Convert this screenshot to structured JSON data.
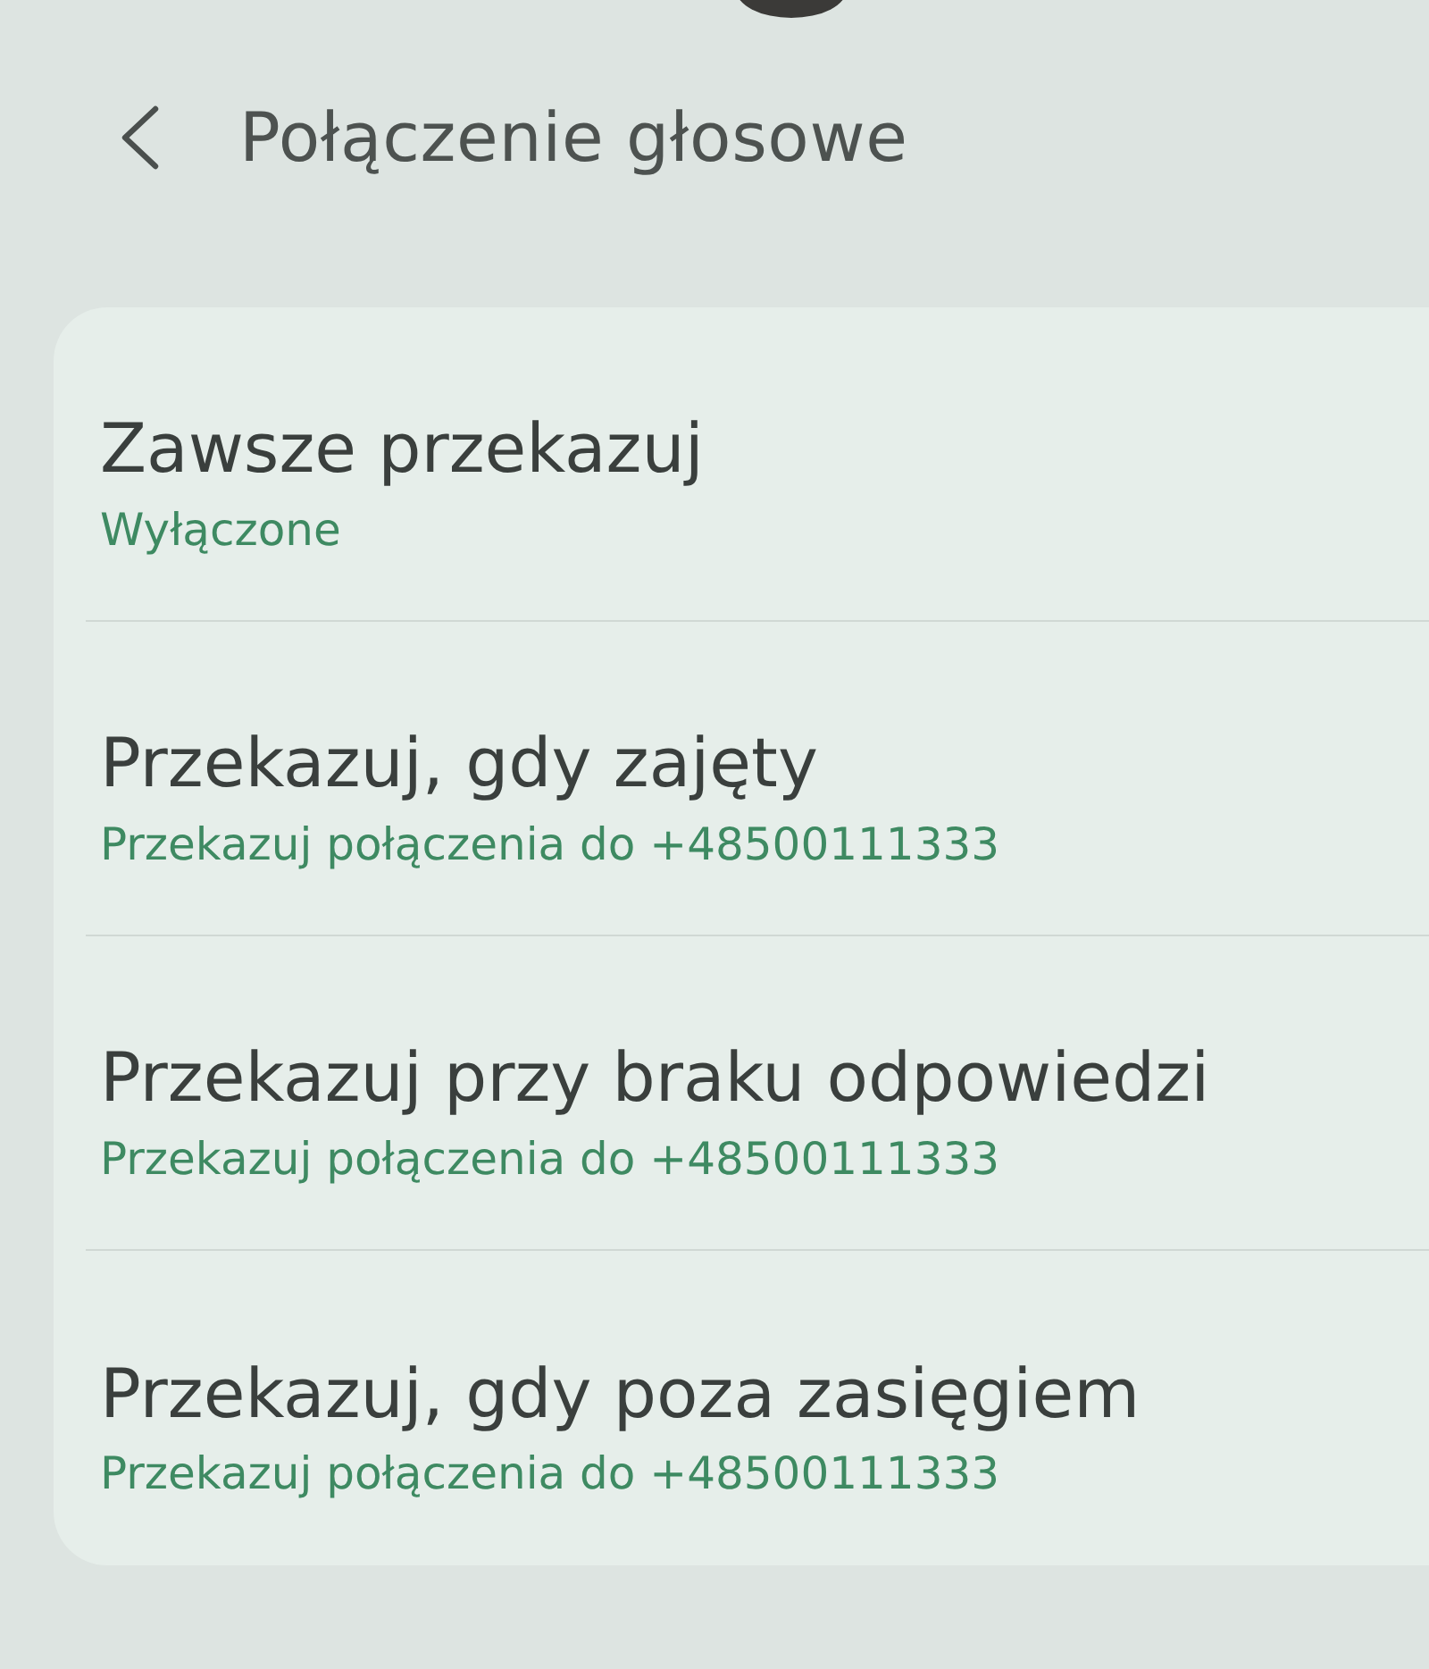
{
  "header": {
    "title": "Połączenie głosowe"
  },
  "items": [
    {
      "title": "Zawsze przekazuj",
      "subtitle": "Wyłączone"
    },
    {
      "title": "Przekazuj, gdy zajęty",
      "subtitle": "Przekazuj połączenia do +48500111333"
    },
    {
      "title": "Przekazuj przy braku odpowiedzi",
      "subtitle": "Przekazuj połączenia do +48500111333"
    },
    {
      "title": "Przekazuj, gdy poza zasięgiem",
      "subtitle": "Przekazuj połączenia do +48500111333"
    }
  ]
}
